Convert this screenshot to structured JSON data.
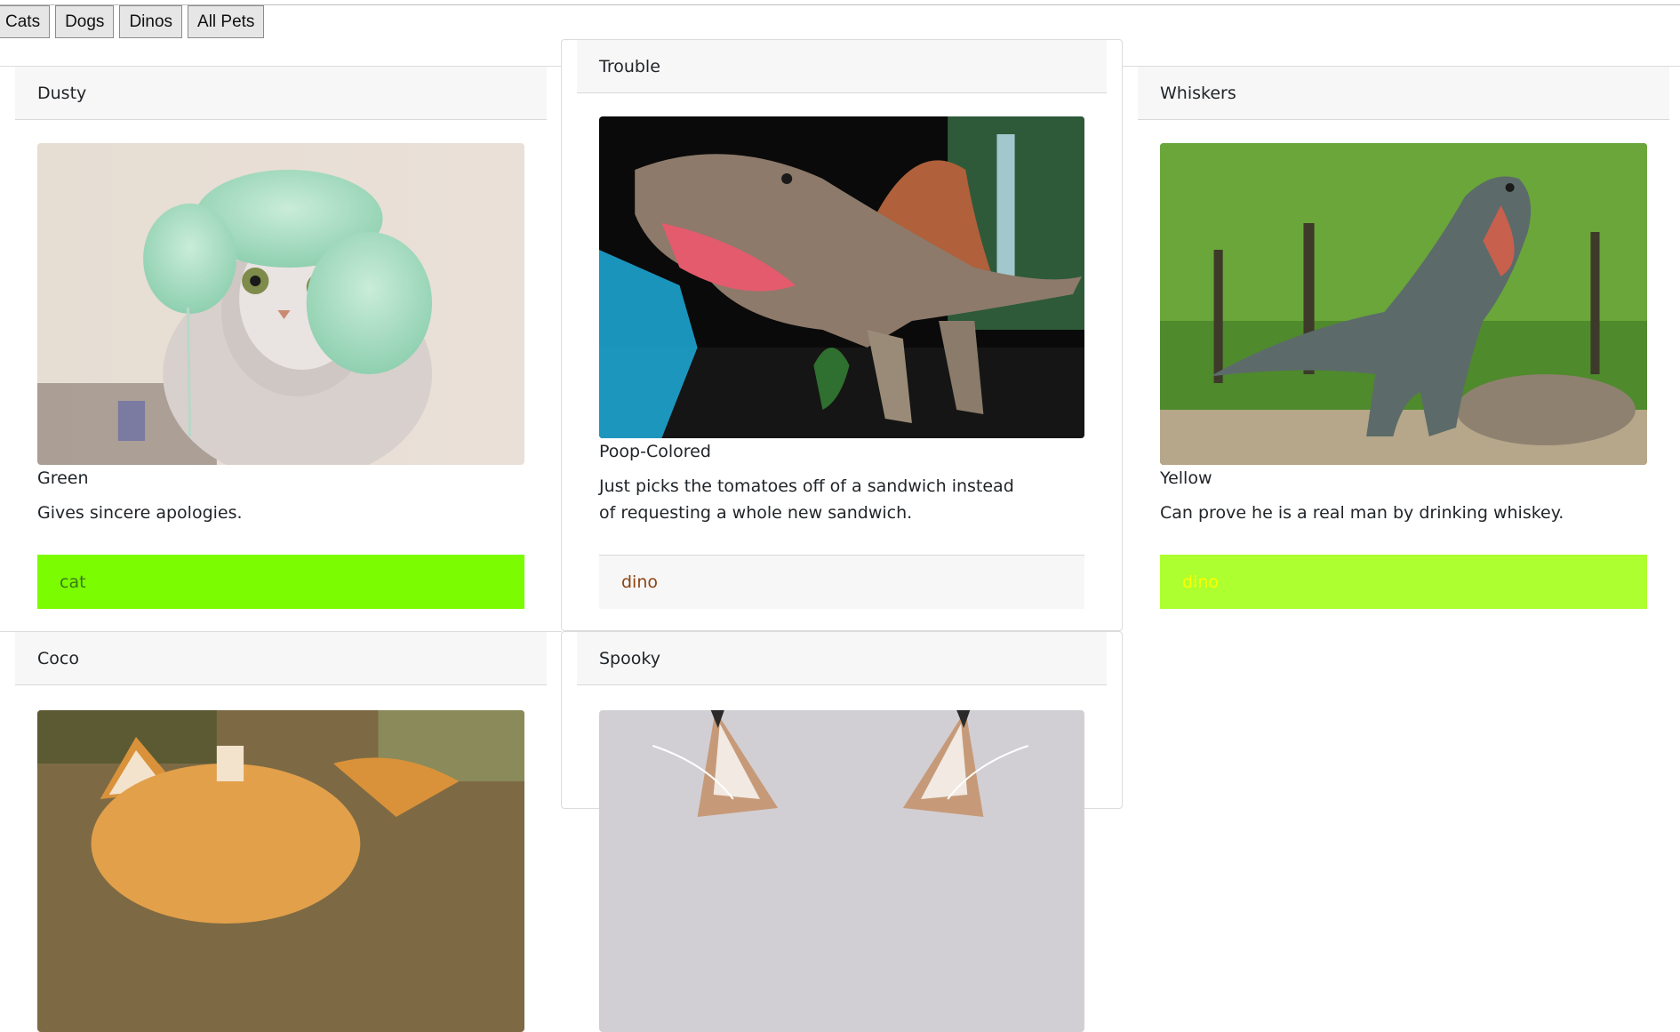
{
  "filters": [
    "Cats",
    "Dogs",
    "Dinos",
    "All Pets"
  ],
  "pets": [
    {
      "name": "Dusty",
      "color": "Green",
      "description": "Gives sincere apologies.",
      "type": "cat",
      "image": "cat-in-knit-hat-photo",
      "footer_bg": "#7cfc00",
      "footer_text": "#3a7a1a"
    },
    {
      "name": "Trouble",
      "color": "Poop-Colored",
      "description": "Just picks the tomatoes off of a sandwich instead of requesting a whole new sandwich.",
      "type": "dino",
      "image": "spinosaurus-model-photo",
      "footer_bg": "#f7f7f7",
      "footer_text": "#8b4513"
    },
    {
      "name": "Whiskers",
      "color": "Yellow",
      "description": "Can prove he is a real man by drinking whiskey.",
      "type": "dino",
      "image": "t-rex-in-forest-photo",
      "footer_bg": "#adff2f",
      "footer_text": "#ffff00"
    },
    {
      "name": "Coco",
      "color": "",
      "description": "",
      "type": "",
      "image": "orange-kitten-photo"
    },
    {
      "name": "Spooky",
      "color": "",
      "description": "",
      "type": "",
      "image": "lynx-cat-ears-photo"
    }
  ]
}
